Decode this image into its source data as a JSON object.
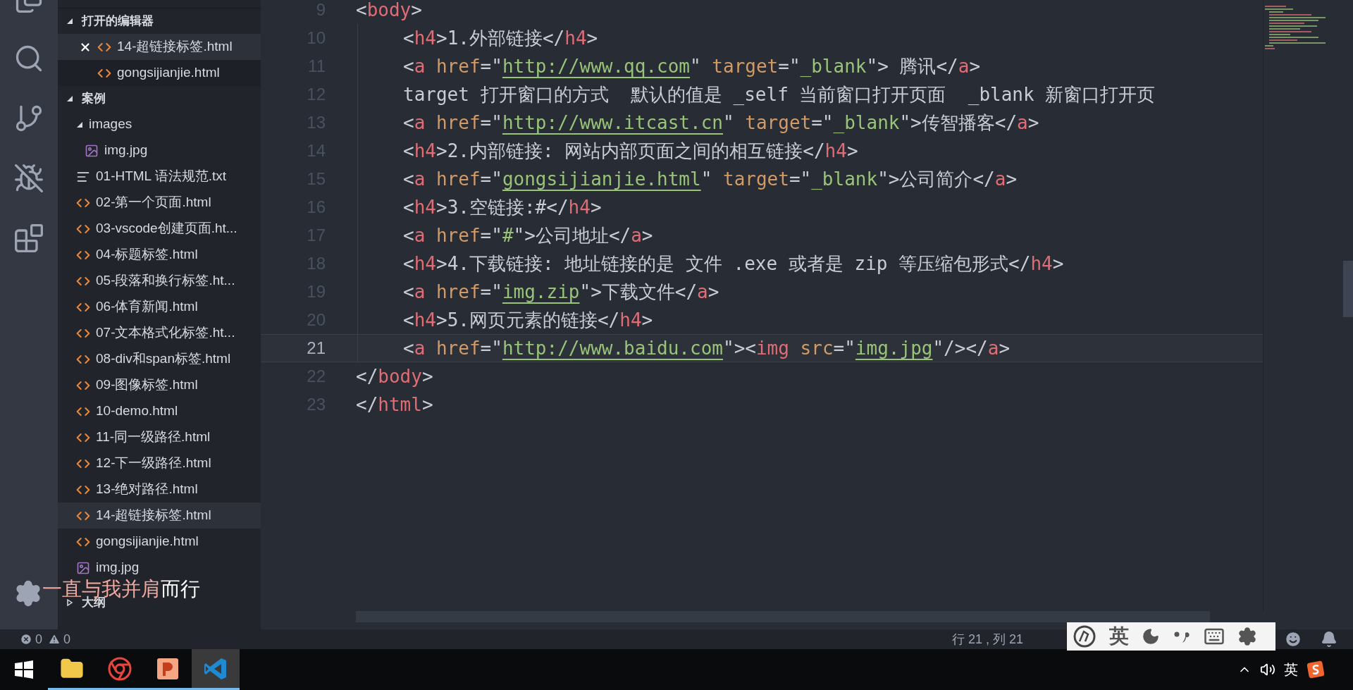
{
  "activity_bar": {
    "items": [
      {
        "kind": "files",
        "selected": false
      },
      {
        "kind": "search",
        "selected": false
      },
      {
        "kind": "git",
        "selected": false
      },
      {
        "kind": "debug",
        "selected": false
      },
      {
        "kind": "extensions",
        "selected": false
      }
    ]
  },
  "sidebar": {
    "sections": [
      {
        "title": "打开的编辑器",
        "expanded": true,
        "items": [
          {
            "name": "14-超链接标签.html",
            "kind": "html",
            "selected": true,
            "closable": true
          },
          {
            "name": "gongsijianjie.html",
            "kind": "html",
            "selected": false,
            "closable": false
          }
        ]
      },
      {
        "title": "案例",
        "expanded": true,
        "items": [
          {
            "name": "images",
            "kind": "folder",
            "selected": false,
            "expanded": true,
            "children": [
              {
                "name": "img.jpg",
                "kind": "image",
                "selected": false
              }
            ]
          },
          {
            "name": "01-HTML 语法规范.txt",
            "kind": "txt",
            "selected": false
          },
          {
            "name": "02-第一个页面.html",
            "kind": "html",
            "selected": false
          },
          {
            "name": "03-vscode创建页面.ht...",
            "kind": "html",
            "selected": false
          },
          {
            "name": "04-标题标签.html",
            "kind": "html",
            "selected": false
          },
          {
            "name": "05-段落和换行标签.ht...",
            "kind": "html",
            "selected": false
          },
          {
            "name": "06-体育新闻.html",
            "kind": "html",
            "selected": false
          },
          {
            "name": "07-文本格式化标签.ht...",
            "kind": "html",
            "selected": false
          },
          {
            "name": "08-div和span标签.html",
            "kind": "html",
            "selected": false
          },
          {
            "name": "09-图像标签.html",
            "kind": "html",
            "selected": false
          },
          {
            "name": "10-demo.html",
            "kind": "html",
            "selected": false
          },
          {
            "name": "11-同一级路径.html",
            "kind": "html",
            "selected": false
          },
          {
            "name": "12-下一级路径.html",
            "kind": "html",
            "selected": false
          },
          {
            "name": "13-绝对路径.html",
            "kind": "html",
            "selected": false
          },
          {
            "name": "14-超链接标签.html",
            "kind": "html",
            "selected": true
          },
          {
            "name": "gongsijianjie.html",
            "kind": "html",
            "selected": false
          },
          {
            "name": "img.jpg",
            "kind": "image",
            "selected": false
          }
        ]
      },
      {
        "title": "大纲",
        "expanded": false
      }
    ]
  },
  "subtitle": {
    "highlighted": "一直与我并肩",
    "rest": "而行"
  },
  "editor": {
    "lines": [
      {
        "number": "9",
        "current": false,
        "tokens": [
          {
            "kind": "p",
            "text": "<"
          },
          {
            "kind": "tag",
            "text": "body"
          },
          {
            "kind": "p",
            "text": ">"
          }
        ],
        "children": [
          {
            "number": "10",
            "current": false,
            "tokens": [
              {
                "kind": "p",
                "text": "<"
              },
              {
                "kind": "tag",
                "text": "h4"
              },
              {
                "kind": "p",
                "text": ">"
              },
              {
                "kind": "plain",
                "text": "1.外部链接"
              },
              {
                "kind": "p",
                "text": "</"
              },
              {
                "kind": "tag",
                "text": "h4"
              },
              {
                "kind": "p",
                "text": ">"
              }
            ]
          },
          {
            "number": "11",
            "current": false,
            "tokens": [
              {
                "kind": "p",
                "text": "<"
              },
              {
                "kind": "tag",
                "text": "a"
              },
              {
                "kind": "attr",
                "text": " href"
              },
              {
                "kind": "p",
                "text": "=\""
              },
              {
                "kind": "link",
                "text": "http://www.qq.com"
              },
              {
                "kind": "p",
                "text": "\""
              },
              {
                "kind": "attr",
                "text": " target"
              },
              {
                "kind": "p",
                "text": "=\""
              },
              {
                "kind": "str",
                "text": "_blank"
              },
              {
                "kind": "p",
                "text": "\">"
              },
              {
                "kind": "plain",
                "text": " 腾讯"
              },
              {
                "kind": "p",
                "text": "</"
              },
              {
                "kind": "tag",
                "text": "a"
              },
              {
                "kind": "p",
                "text": ">"
              }
            ]
          },
          {
            "number": "12",
            "current": false,
            "tokens": [
              {
                "kind": "plain",
                "text": "target 打开窗口的方式  默认的值是 _self 当前窗口打开页面  _blank 新窗口打开页"
              }
            ]
          },
          {
            "number": "13",
            "current": false,
            "tokens": [
              {
                "kind": "p",
                "text": "<"
              },
              {
                "kind": "tag",
                "text": "a"
              },
              {
                "kind": "attr",
                "text": " href"
              },
              {
                "kind": "p",
                "text": "=\""
              },
              {
                "kind": "link",
                "text": "http://www.itcast.cn"
              },
              {
                "kind": "p",
                "text": "\""
              },
              {
                "kind": "attr",
                "text": " target"
              },
              {
                "kind": "p",
                "text": "=\""
              },
              {
                "kind": "str",
                "text": "_blank"
              },
              {
                "kind": "p",
                "text": "\">"
              },
              {
                "kind": "plain",
                "text": "传智播客"
              },
              {
                "kind": "p",
                "text": "</"
              },
              {
                "kind": "tag",
                "text": "a"
              },
              {
                "kind": "p",
                "text": ">"
              }
            ]
          },
          {
            "number": "14",
            "current": false,
            "tokens": [
              {
                "kind": "p",
                "text": "<"
              },
              {
                "kind": "tag",
                "text": "h4"
              },
              {
                "kind": "p",
                "text": ">"
              },
              {
                "kind": "plain",
                "text": "2.内部链接: 网站内部页面之间的相互链接"
              },
              {
                "kind": "p",
                "text": "</"
              },
              {
                "kind": "tag",
                "text": "h4"
              },
              {
                "kind": "p",
                "text": ">"
              }
            ]
          },
          {
            "number": "15",
            "current": false,
            "tokens": [
              {
                "kind": "p",
                "text": "<"
              },
              {
                "kind": "tag",
                "text": "a"
              },
              {
                "kind": "attr",
                "text": " href"
              },
              {
                "kind": "p",
                "text": "=\""
              },
              {
                "kind": "link",
                "text": "gongsijianjie.html"
              },
              {
                "kind": "p",
                "text": "\""
              },
              {
                "kind": "attr",
                "text": " target"
              },
              {
                "kind": "p",
                "text": "=\""
              },
              {
                "kind": "str",
                "text": "_blank"
              },
              {
                "kind": "p",
                "text": "\">"
              },
              {
                "kind": "plain",
                "text": "公司简介"
              },
              {
                "kind": "p",
                "text": "</"
              },
              {
                "kind": "tag",
                "text": "a"
              },
              {
                "kind": "p",
                "text": ">"
              }
            ]
          },
          {
            "number": "16",
            "current": false,
            "tokens": [
              {
                "kind": "p",
                "text": "<"
              },
              {
                "kind": "tag",
                "text": "h4"
              },
              {
                "kind": "p",
                "text": ">"
              },
              {
                "kind": "plain",
                "text": "3.空链接:#"
              },
              {
                "kind": "p",
                "text": "</"
              },
              {
                "kind": "tag",
                "text": "h4"
              },
              {
                "kind": "p",
                "text": ">"
              }
            ]
          },
          {
            "number": "17",
            "current": false,
            "tokens": [
              {
                "kind": "p",
                "text": "<"
              },
              {
                "kind": "tag",
                "text": "a"
              },
              {
                "kind": "attr",
                "text": " href"
              },
              {
                "kind": "p",
                "text": "=\""
              },
              {
                "kind": "str",
                "text": "#"
              },
              {
                "kind": "p",
                "text": "\">"
              },
              {
                "kind": "plain",
                "text": "公司地址"
              },
              {
                "kind": "p",
                "text": "</"
              },
              {
                "kind": "tag",
                "text": "a"
              },
              {
                "kind": "p",
                "text": ">"
              }
            ]
          },
          {
            "number": "18",
            "current": false,
            "tokens": [
              {
                "kind": "p",
                "text": "<"
              },
              {
                "kind": "tag",
                "text": "h4"
              },
              {
                "kind": "p",
                "text": ">"
              },
              {
                "kind": "plain",
                "text": "4.下载链接: 地址链接的是 文件 .exe 或者是 zip 等压缩包形式"
              },
              {
                "kind": "p",
                "text": "</"
              },
              {
                "kind": "tag",
                "text": "h4"
              },
              {
                "kind": "p",
                "text": ">"
              }
            ]
          },
          {
            "number": "19",
            "current": false,
            "tokens": [
              {
                "kind": "p",
                "text": "<"
              },
              {
                "kind": "tag",
                "text": "a"
              },
              {
                "kind": "attr",
                "text": " href"
              },
              {
                "kind": "p",
                "text": "=\""
              },
              {
                "kind": "link",
                "text": "img.zip"
              },
              {
                "kind": "p",
                "text": "\">"
              },
              {
                "kind": "plain",
                "text": "下载文件"
              },
              {
                "kind": "p",
                "text": "</"
              },
              {
                "kind": "tag",
                "text": "a"
              },
              {
                "kind": "p",
                "text": ">"
              }
            ]
          },
          {
            "number": "20",
            "current": false,
            "tokens": [
              {
                "kind": "p",
                "text": "<"
              },
              {
                "kind": "tag",
                "text": "h4"
              },
              {
                "kind": "p",
                "text": ">"
              },
              {
                "kind": "plain",
                "text": "5.网页元素的链接"
              },
              {
                "kind": "p",
                "text": "</"
              },
              {
                "kind": "tag",
                "text": "h4"
              },
              {
                "kind": "p",
                "text": ">"
              }
            ]
          },
          {
            "number": "21",
            "current": true,
            "tokens": [
              {
                "kind": "p",
                "text": "<"
              },
              {
                "kind": "tag",
                "text": "a"
              },
              {
                "kind": "attr",
                "text": " href"
              },
              {
                "kind": "p",
                "text": "=\""
              },
              {
                "kind": "link",
                "text": "http://www.baidu.com"
              },
              {
                "kind": "p",
                "text": "\">"
              },
              {
                "kind": "p",
                "text": "<"
              },
              {
                "kind": "tag",
                "text": "img"
              },
              {
                "kind": "attr",
                "text": " src"
              },
              {
                "kind": "p",
                "text": "=\""
              },
              {
                "kind": "link",
                "text": "img.jpg"
              },
              {
                "kind": "p",
                "text": "\"/></"
              },
              {
                "kind": "tag",
                "text": "a"
              },
              {
                "kind": "p",
                "text": ">"
              }
            ]
          }
        ]
      },
      {
        "number": "22",
        "current": false,
        "tokens": [
          {
            "kind": "p",
            "text": "</"
          },
          {
            "kind": "tag",
            "text": "body"
          },
          {
            "kind": "p",
            "text": ">"
          }
        ]
      },
      {
        "number": "23",
        "current": false,
        "tokens": [
          {
            "kind": "p",
            "text": "</"
          },
          {
            "kind": "tag",
            "text": "html"
          },
          {
            "kind": "p",
            "text": ">"
          }
        ]
      }
    ]
  },
  "status_bar": {
    "errors": "0",
    "warnings": "0",
    "position": "行 21 , 列 21"
  },
  "ime_toolbar": {
    "language": "英"
  },
  "taskbar": {
    "apps": [
      {
        "kind": "explorer",
        "selected": false
      },
      {
        "kind": "chrome",
        "selected": false
      },
      {
        "kind": "powerpoint",
        "selected": false
      },
      {
        "kind": "vscode",
        "selected": true
      }
    ],
    "tray_language": "英"
  }
}
